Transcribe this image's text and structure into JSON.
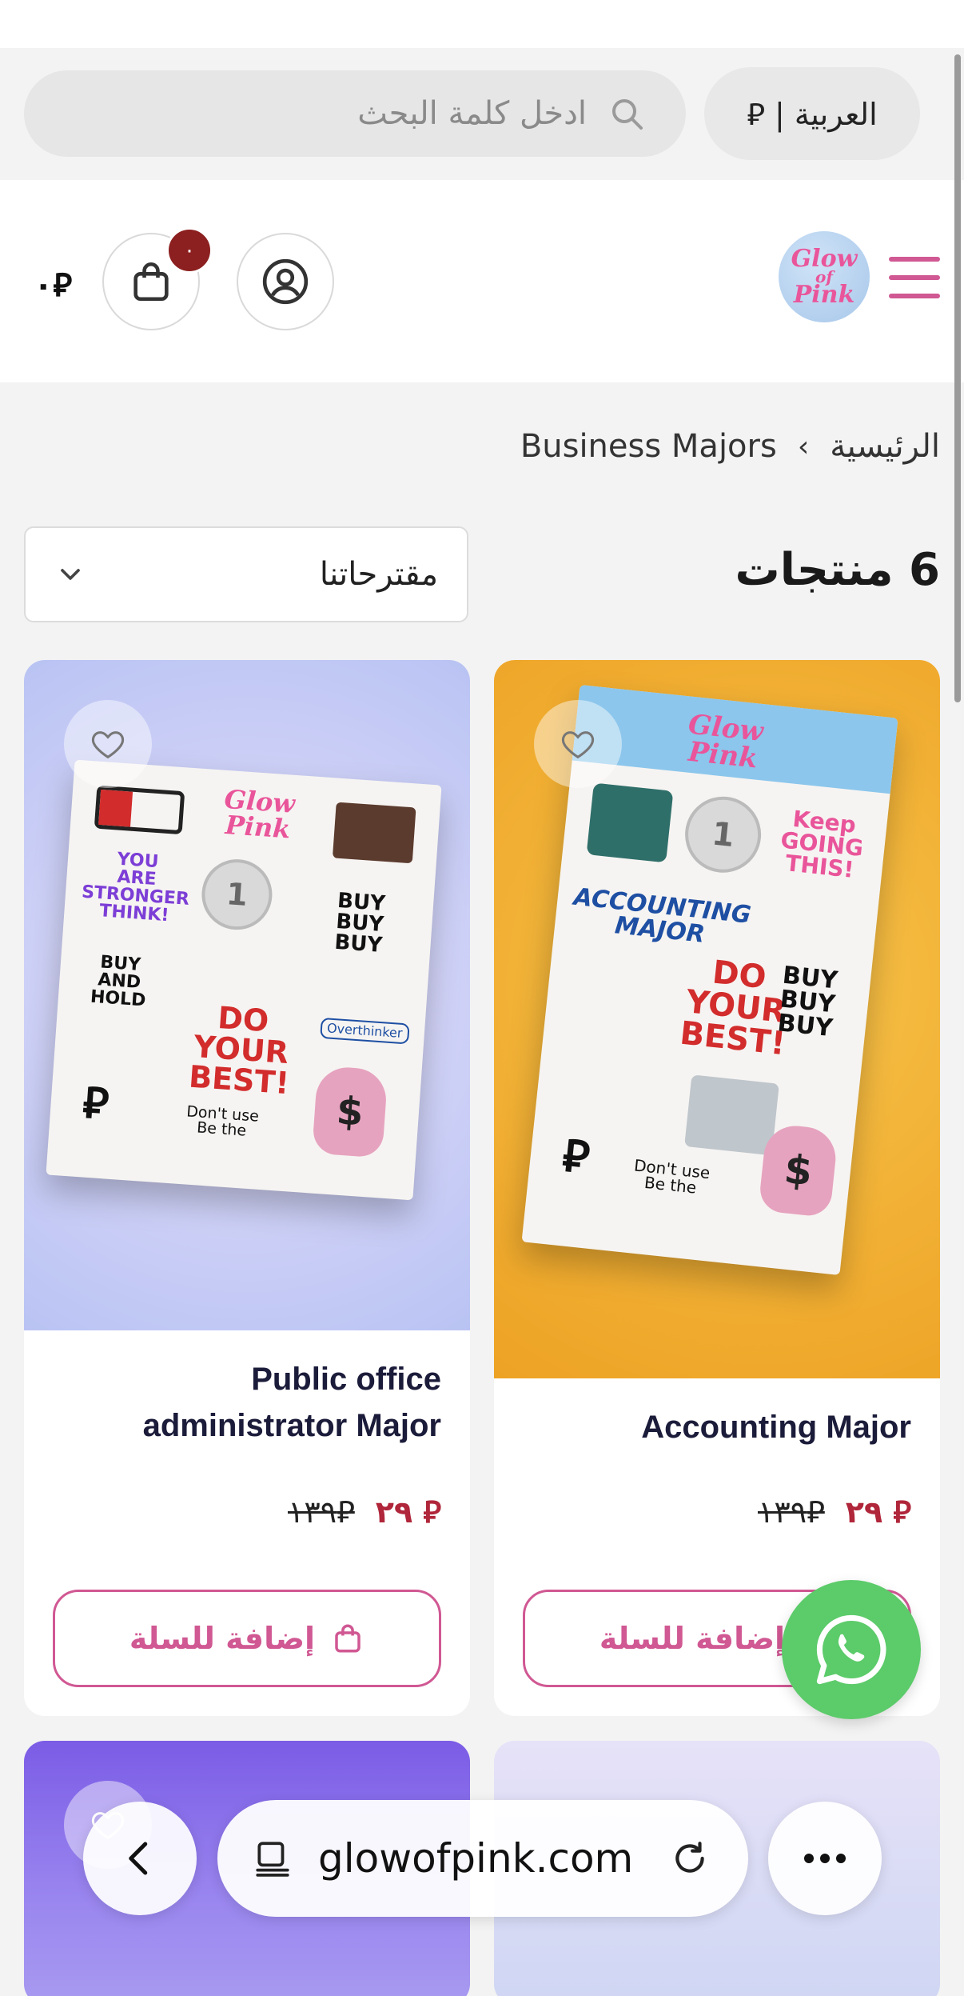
{
  "topbar": {
    "language_label": "العربية | ⃁",
    "search_placeholder": "ادخل كلمة البحث"
  },
  "header": {
    "logo_text": [
      "Glow",
      "of",
      "Pink"
    ],
    "cart_count": "٠",
    "cart_total": "⃁٠"
  },
  "breadcrumb": {
    "home": "الرئيسية",
    "separator": "›",
    "current": "Business Majors"
  },
  "listing": {
    "count_title": "6 منتجات",
    "sort_label": "مقترحاتنا"
  },
  "products": [
    {
      "name": "Accounting Major",
      "price_sale": "⃁ ٢٩",
      "price_old": "⃁١٣٩",
      "add_to_cart": "إضافة للسلة"
    },
    {
      "name": "Public office administrator Major",
      "price_sale": "⃁ ٢٩",
      "price_old": "⃁١٣٩",
      "add_to_cart": "إضافة للسلة"
    }
  ],
  "browser": {
    "url": "glowofpink.com"
  },
  "colors": {
    "accent": "#d05893",
    "sale_price": "#b0263a",
    "cart_badge": "#8c1f1f",
    "whatsapp": "#5ccb6a"
  }
}
